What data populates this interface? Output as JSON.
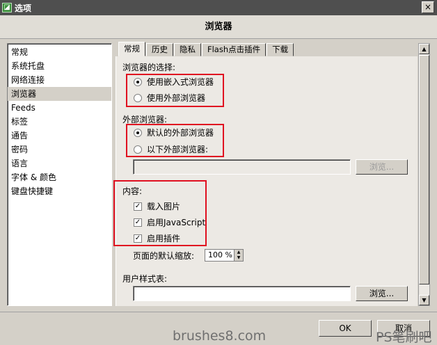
{
  "window": {
    "title": "选项",
    "app_icon": "app-icon",
    "close_symbol": "×"
  },
  "header": {
    "title": "浏览器"
  },
  "sidebar": {
    "items": [
      {
        "label": "常规"
      },
      {
        "label": "系统托盘"
      },
      {
        "label": "网络连接"
      },
      {
        "label": "浏览器"
      },
      {
        "label": "Feeds"
      },
      {
        "label": "标签"
      },
      {
        "label": "通告"
      },
      {
        "label": "密码"
      },
      {
        "label": "语言"
      },
      {
        "label": "字体 & 颜色"
      },
      {
        "label": "键盘快捷键"
      }
    ],
    "selected_index": 3
  },
  "tabs": [
    {
      "label": "常规"
    },
    {
      "label": "历史"
    },
    {
      "label": "隐私"
    },
    {
      "label": "Flash点击插件"
    },
    {
      "label": "下载"
    }
  ],
  "browser_choice": {
    "label": "浏览器的选择:",
    "options": [
      {
        "label": "使用嵌入式浏览器",
        "selected": true
      },
      {
        "label": "使用外部浏览器",
        "selected": false
      }
    ]
  },
  "external_browser": {
    "label": "外部浏览器:",
    "options": [
      {
        "label": "默认的外部浏览器",
        "selected": true
      },
      {
        "label": "以下外部浏览器:",
        "selected": false
      }
    ],
    "path_value": "",
    "browse_label": "浏览..."
  },
  "content_section": {
    "label": "内容:",
    "checks": [
      {
        "label": "载入图片",
        "checked": true
      },
      {
        "label": "启用JavaScript",
        "checked": true
      },
      {
        "label": "启用插件",
        "checked": true
      }
    ],
    "zoom_label": "页面的默认缩放:",
    "zoom_value": "100 %"
  },
  "stylesheet": {
    "label": "用户样式表:",
    "value": "",
    "browse_label": "浏览..."
  },
  "footer": {
    "ok_label": "OK",
    "cancel_label": "取消"
  },
  "watermarks": {
    "left": "brushes8.com",
    "right": "PS笔刷吧"
  },
  "colors": {
    "highlight_box": "#e01020",
    "titlebar": "#4f4f4f"
  }
}
